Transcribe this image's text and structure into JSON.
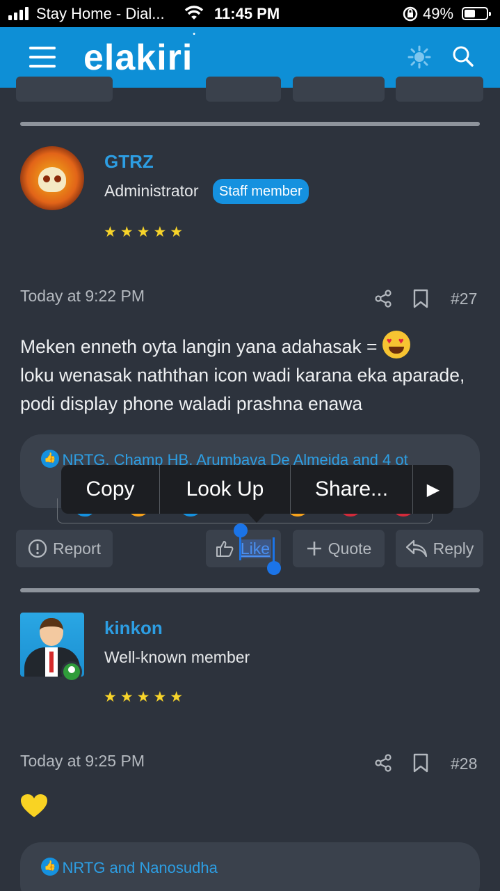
{
  "status_bar": {
    "carrier": "Stay Home - Dial...",
    "time": "11:45 PM",
    "battery_percent": "49%"
  },
  "header": {
    "logo_text": "elakiri",
    "logo_mark": "•",
    "brand_color": "#0e8fd6"
  },
  "posts": [
    {
      "username": "GTRZ",
      "role": "Administrator",
      "badge": "Staff member",
      "stars": "★★★★★",
      "date": "Today at 9:22 PM",
      "post_number": "#27",
      "body_line1": "Meken enneth oyta langin yana adahasak = ",
      "body_rest": "loku wenasak naththan icon wadi karana eka aparade, podi display phone waladi prashna enawa",
      "reactions_text": "NRTG, Champ HB, Arumbava De Almeida and 4 ot",
      "actions": {
        "report": "Report",
        "like": "Like",
        "quote": "Quote",
        "reply": "Reply"
      }
    },
    {
      "username": "kinkon",
      "role": "Well-known member",
      "stars": "★★★★★",
      "date": "Today at 9:25 PM",
      "post_number": "#28",
      "reactions_text": "NRTG and Nanosudha"
    }
  ],
  "callout_menu": {
    "copy": "Copy",
    "look_up": "Look Up",
    "share": "Share...",
    "more": "▶"
  }
}
